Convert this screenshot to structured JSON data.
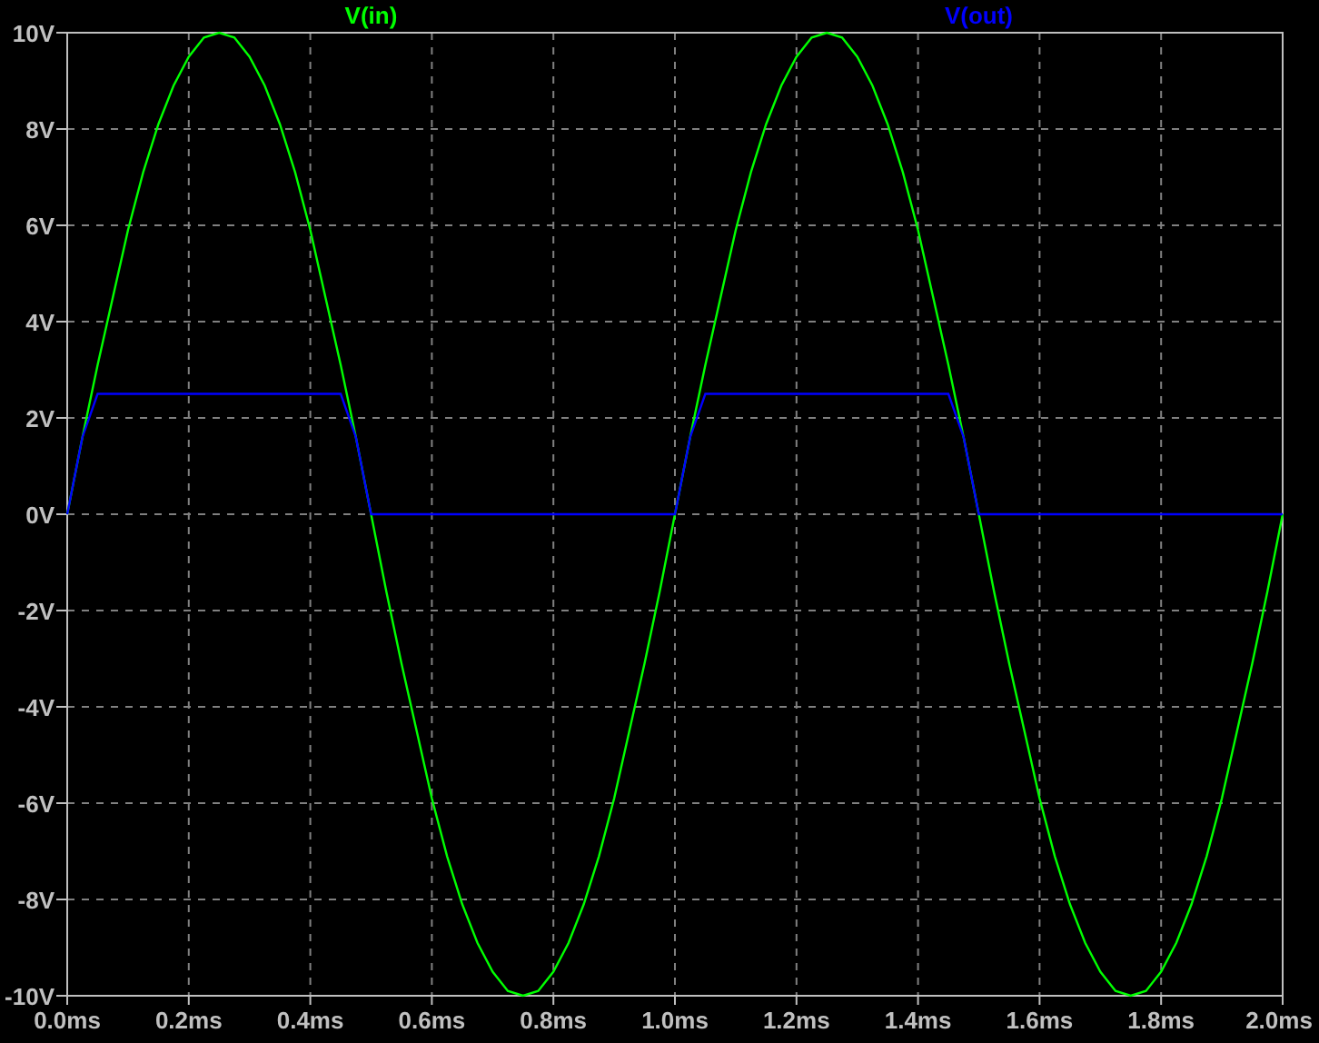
{
  "plot": {
    "chart_data": {
      "type": "line",
      "grid": true,
      "x": [
        0,
        0.025,
        0.05,
        0.075,
        0.1,
        0.125,
        0.15,
        0.175,
        0.2,
        0.225,
        0.25,
        0.275,
        0.3,
        0.325,
        0.35,
        0.375,
        0.4,
        0.425,
        0.45,
        0.475,
        0.5,
        0.525,
        0.55,
        0.575,
        0.6,
        0.625,
        0.65,
        0.675,
        0.7,
        0.725,
        0.75,
        0.775,
        0.8,
        0.825,
        0.85,
        0.875,
        0.9,
        0.925,
        0.95,
        0.975,
        1,
        1.025,
        1.05,
        1.075,
        1.1,
        1.125,
        1.15,
        1.175,
        1.2,
        1.225,
        1.25,
        1.275,
        1.3,
        1.325,
        1.35,
        1.375,
        1.4,
        1.425,
        1.45,
        1.475,
        1.5,
        1.525,
        1.55,
        1.575,
        1.6,
        1.625,
        1.65,
        1.675,
        1.7,
        1.725,
        1.75,
        1.775,
        1.8,
        1.825,
        1.85,
        1.875,
        1.9,
        1.925,
        1.95,
        1.975,
        2
      ],
      "series": [
        {
          "name": "V(in)",
          "color": "#00ff00",
          "values": [
            0,
            1.6,
            3.1,
            4.5,
            5.9,
            7.1,
            8.1,
            8.9,
            9.5,
            9.9,
            10,
            9.9,
            9.5,
            8.9,
            8.1,
            7.1,
            5.9,
            4.5,
            3.1,
            1.6,
            0,
            -1.6,
            -3.1,
            -4.5,
            -5.9,
            -7.1,
            -8.1,
            -8.9,
            -9.5,
            -9.9,
            -10,
            -9.9,
            -9.5,
            -8.9,
            -8.1,
            -7.1,
            -5.9,
            -4.5,
            -3.1,
            -1.6,
            0,
            1.6,
            3.1,
            4.5,
            5.9,
            7.1,
            8.1,
            8.9,
            9.5,
            9.9,
            10,
            9.9,
            9.5,
            8.9,
            8.1,
            7.1,
            5.9,
            4.5,
            3.1,
            1.6,
            0,
            -1.6,
            -3.1,
            -4.5,
            -5.9,
            -7.1,
            -8.1,
            -8.9,
            -9.5,
            -9.9,
            -10,
            -9.9,
            -9.5,
            -8.9,
            -8.1,
            -7.1,
            -5.9,
            -4.5,
            -3.1,
            -1.6,
            0
          ]
        },
        {
          "name": "V(out)",
          "color": "#0000ff",
          "values": [
            0,
            1.6,
            2.5,
            2.5,
            2.5,
            2.5,
            2.5,
            2.5,
            2.5,
            2.5,
            2.5,
            2.5,
            2.5,
            2.5,
            2.5,
            2.5,
            2.5,
            2.5,
            2.5,
            1.6,
            0,
            0,
            0,
            0,
            0,
            0,
            0,
            0,
            0,
            0,
            0,
            0,
            0,
            0,
            0,
            0,
            0,
            0,
            0,
            0,
            0,
            1.6,
            2.5,
            2.5,
            2.5,
            2.5,
            2.5,
            2.5,
            2.5,
            2.5,
            2.5,
            2.5,
            2.5,
            2.5,
            2.5,
            2.5,
            2.5,
            2.5,
            2.5,
            1.6,
            0,
            0,
            0,
            0,
            0,
            0,
            0,
            0,
            0,
            0,
            0,
            0,
            0,
            0,
            0,
            0,
            0,
            0,
            0,
            0,
            0
          ]
        }
      ],
      "xlim": [
        0,
        2
      ],
      "ylim": [
        -10,
        10
      ],
      "xticks": [
        {
          "value": 0,
          "label": "0.0ms"
        },
        {
          "value": 0.2,
          "label": "0.2ms"
        },
        {
          "value": 0.4,
          "label": "0.4ms"
        },
        {
          "value": 0.6,
          "label": "0.6ms"
        },
        {
          "value": 0.8,
          "label": "0.8ms"
        },
        {
          "value": 1,
          "label": "1.0ms"
        },
        {
          "value": 1.2,
          "label": "1.2ms"
        },
        {
          "value": 1.4,
          "label": "1.4ms"
        },
        {
          "value": 1.6,
          "label": "1.6ms"
        },
        {
          "value": 1.8,
          "label": "1.8ms"
        },
        {
          "value": 2,
          "label": "2.0ms"
        }
      ],
      "yticks": [
        {
          "value": 10,
          "label": "10V"
        },
        {
          "value": 8,
          "label": "8V"
        },
        {
          "value": 6,
          "label": "6V"
        },
        {
          "value": 4,
          "label": "4V"
        },
        {
          "value": 2,
          "label": "2V"
        },
        {
          "value": 0,
          "label": "0V"
        },
        {
          "value": -2,
          "label": "-2V"
        },
        {
          "value": -4,
          "label": "-4V"
        },
        {
          "value": -6,
          "label": "-6V"
        },
        {
          "value": -8,
          "label": "-8V"
        },
        {
          "value": -10,
          "label": "-10V"
        }
      ]
    }
  }
}
